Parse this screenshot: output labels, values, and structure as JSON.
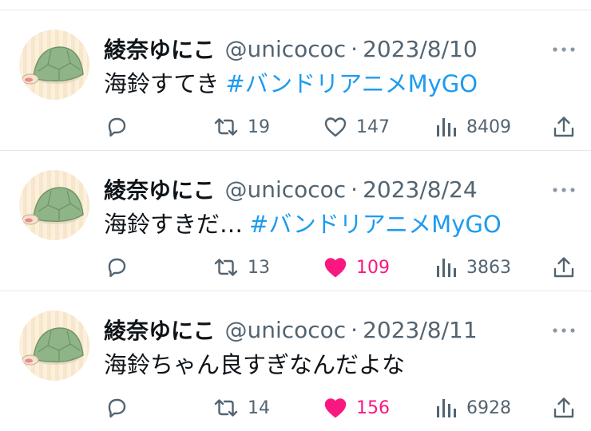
{
  "tweets": [
    {
      "display_name": "綾奈ゆにこ",
      "handle": "@unicococ",
      "separator": "·",
      "date": "2023/8/10",
      "text": "海鈴すてき",
      "hashtag": "#バンドリアニメMyGO",
      "retweets": "19",
      "likes": "147",
      "liked": false,
      "views": "8409"
    },
    {
      "display_name": "綾奈ゆにこ",
      "handle": "@unicococ",
      "separator": "·",
      "date": "2023/8/24",
      "text": "海鈴すきだ…",
      "hashtag": "#バンドリアニメMyGO",
      "retweets": "13",
      "likes": "109",
      "liked": true,
      "views": "3863"
    },
    {
      "display_name": "綾奈ゆにこ",
      "handle": "@unicococ",
      "separator": "·",
      "date": "2023/8/11",
      "text": "海鈴ちゃん良すぎなんだよな",
      "hashtag": "",
      "retweets": "14",
      "likes": "156",
      "liked": true,
      "views": "6928"
    }
  ],
  "colors": {
    "link": "#1d9bf0",
    "like_active": "#f91880",
    "secondary_text": "#536471",
    "divider": "#e6e9ec"
  },
  "icons": [
    "more-icon",
    "reply-icon",
    "retweet-icon",
    "like-icon",
    "views-icon",
    "share-icon"
  ]
}
